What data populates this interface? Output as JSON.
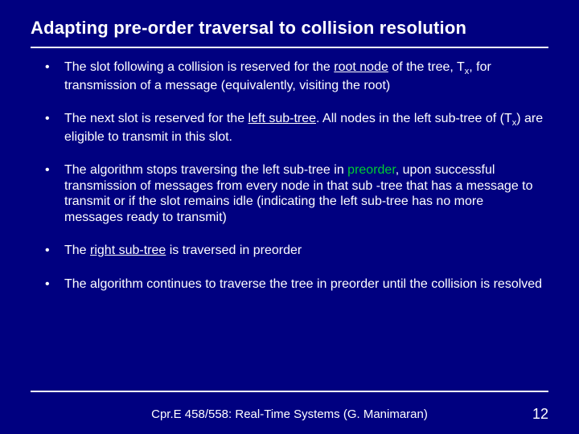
{
  "title": "Adapting pre-order traversal to collision resolution",
  "bullets": [
    {
      "pre": "The slot following a collision is reserved for the ",
      "u1": "root node",
      "mid1": " of the tree, T",
      "sub1": "x",
      "post1": ", for transmission of a message (equivalently, visiting the root)"
    },
    {
      "pre": "The next slot is reserved for the ",
      "u1": "left sub-tree",
      "mid1": ". All nodes in the left sub-tree of (T",
      "sub1": "x",
      "post1": ") are eligible to transmit in this slot."
    },
    {
      "pre": "The algorithm stops traversing the left sub-tree in ",
      "g1": "preorder",
      "post1": ", upon successful transmission of messages from every node in that sub -tree that has a message to transmit or if the slot remains idle (indicating the left sub-tree has no more messages ready to transmit)"
    },
    {
      "pre": "The ",
      "u1": "right sub-tree",
      "post1": " is traversed in preorder"
    },
    {
      "pre": "The algorithm continues to traverse the tree in preorder until the collision is resolved"
    }
  ],
  "footer_text": "Cpr.E 458/558: Real-Time Systems (G. Manimaran)",
  "page_number": "12"
}
